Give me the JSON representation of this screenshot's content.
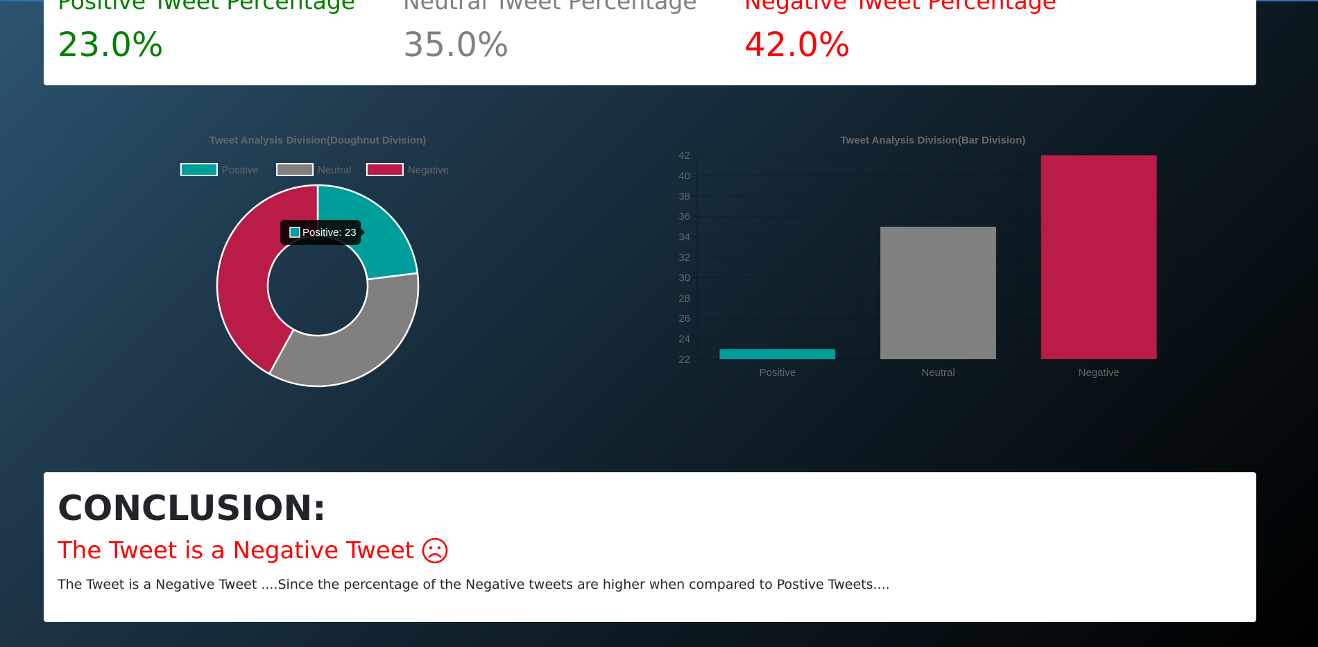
{
  "stats": {
    "positive_label": "Positive Tweet Percentage",
    "positive_value": "23.0%",
    "neutral_label": "Neutral Tweet Percentage",
    "neutral_value": "35.0%",
    "negative_label": "Negative Tweet Percentage",
    "negative_value": "42.0%"
  },
  "colors": {
    "positive": "#009e9a",
    "neutral": "#808080",
    "negative": "#b91c47",
    "positive_text": "#008000",
    "neutral_text": "#808080",
    "negative_text": "#ff0000"
  },
  "chart_data": [
    {
      "type": "pie",
      "title": "Tweet Analysis Division(Doughnut Division)",
      "categories": [
        "Positive",
        "Neutral",
        "Negative"
      ],
      "values": [
        23,
        35,
        42
      ],
      "legend": "top",
      "tooltip": "Positive: 23"
    },
    {
      "type": "bar",
      "title": "Tweet Analysis Division(Bar Division)",
      "categories": [
        "Positive",
        "Neutral",
        "Negative"
      ],
      "values": [
        23,
        35,
        42
      ],
      "ylim": [
        22,
        42
      ],
      "yticks": [
        "42",
        "40",
        "38",
        "36",
        "34",
        "32",
        "30",
        "28",
        "26",
        "24",
        "22"
      ],
      "grid": true
    }
  ],
  "conclusion": {
    "heading": "CONCLUSION:",
    "verdict": "The Tweet is a Negative Tweet",
    "verdict_icon": "sad-face-icon",
    "text": "The Tweet is a Negative Tweet ....Since the percentage of the Negative tweets are higher when compared to Postive Tweets...."
  }
}
